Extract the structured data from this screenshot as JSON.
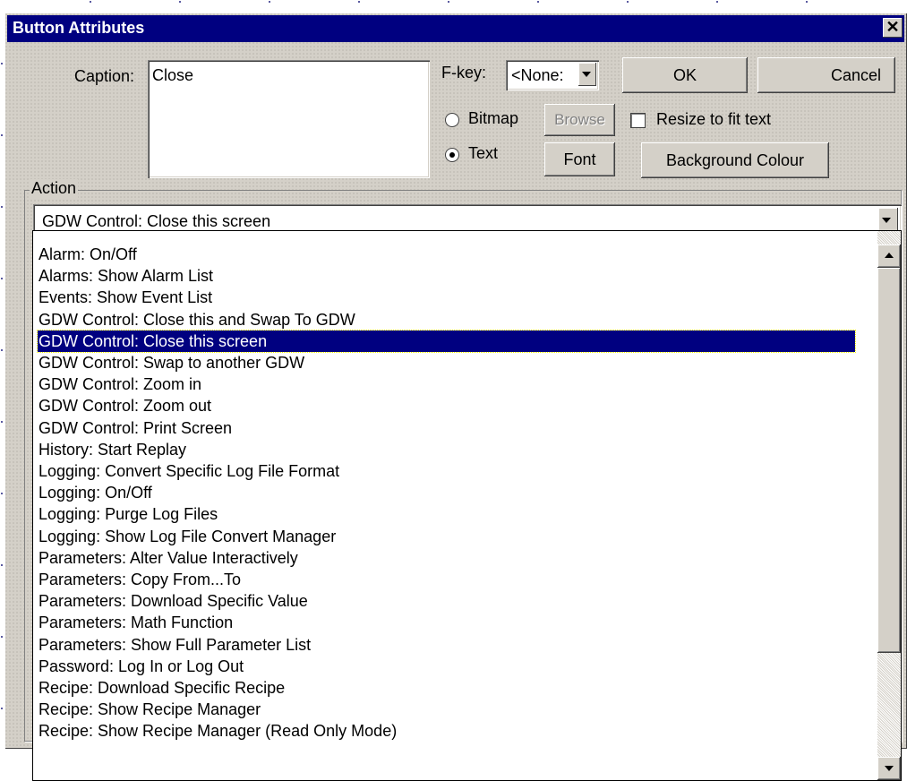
{
  "window": {
    "title": "Button Attributes",
    "close_glyph": "✕"
  },
  "caption": {
    "label": "Caption:",
    "value": "Close"
  },
  "fkey": {
    "label": "F-key:",
    "selected": "<None:"
  },
  "buttons": {
    "ok": "OK",
    "cancel": "Cancel",
    "browse": "Browse",
    "font": "Font",
    "background": "Background Colour"
  },
  "display_mode": {
    "bitmap_label": "Bitmap",
    "text_label": "Text",
    "selected": "Text"
  },
  "resize_to_fit": {
    "label": "Resize to fit text",
    "checked": false
  },
  "action": {
    "group_label": "Action",
    "selected": "GDW Control:  Close this screen",
    "items": [
      "Alarm: On/Off",
      "Alarms: Show Alarm List",
      "Events: Show Event List",
      "GDW Control:  Close this and Swap To GDW",
      "GDW Control:  Close this screen",
      "GDW Control:  Swap to another GDW",
      "GDW Control:  Zoom in",
      "GDW Control:  Zoom out",
      "GDW Control: Print Screen",
      "History: Start Replay",
      "Logging: Convert Specific Log File Format",
      "Logging: On/Off",
      "Logging: Purge Log Files",
      "Logging: Show Log File Convert Manager",
      "Parameters: Alter Value Interactively",
      "Parameters: Copy From...To",
      "Parameters: Download Specific Value",
      "Parameters: Math Function",
      "Parameters: Show Full Parameter List",
      "Password: Log In or Log Out",
      "Recipe: Download Specific Recipe",
      "Recipe: Show Recipe Manager",
      "Recipe: Show Recipe Manager (Read Only Mode)"
    ],
    "selected_index": 4
  },
  "colors": {
    "titlebar": "#000080",
    "face": "#d4d0c8",
    "selection": "#000080"
  }
}
